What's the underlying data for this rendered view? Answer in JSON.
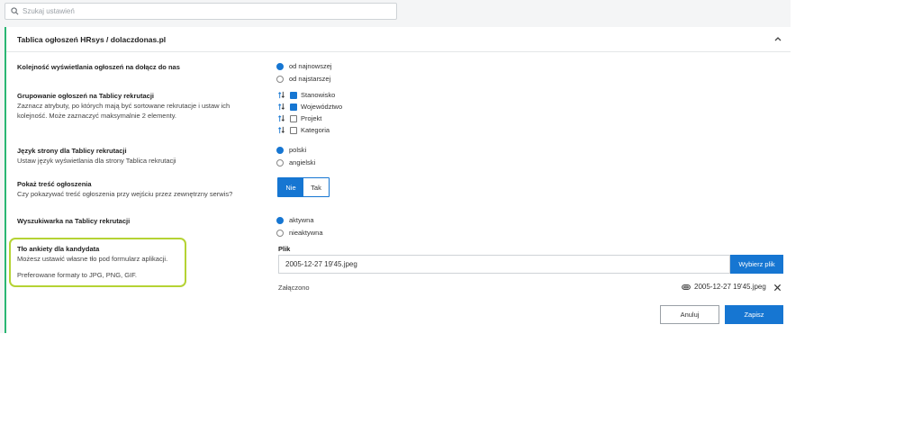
{
  "search": {
    "placeholder": "Szukaj ustawień",
    "icon": "search-icon"
  },
  "panel": {
    "title": "Tablica ogłoszeń HRsys / dolaczdonas.pl",
    "accent": "#2bb673"
  },
  "order": {
    "label": "Kolejność wyświetlania ogłoszeń na dołącz do nas",
    "options": [
      "od najnowszej",
      "od najstarszej"
    ],
    "selected": "od najnowszej"
  },
  "grouping": {
    "label": "Grupowanie ogłoszeń na Tablicy rekrutacji",
    "desc_line1": "Zaznacz atrybuty, po których mają być sortowane rekrutacje i ustaw ich",
    "desc_line2": "kolejność. Może zaznaczyć maksymalnie 2 elementy.",
    "items": [
      {
        "label": "Stanowisko",
        "checked": true
      },
      {
        "label": "Województwo",
        "checked": true
      },
      {
        "label": "Projekt",
        "checked": false
      },
      {
        "label": "Kategoria",
        "checked": false
      }
    ]
  },
  "language": {
    "label": "Język strony dla Tablicy rekrutacji",
    "desc": "Ustaw język wyświetlania dla strony Tablica rekrutacji",
    "options": [
      "polski",
      "angielski"
    ],
    "selected": "polski"
  },
  "show_content": {
    "label": "Pokaż treść ogłoszenia",
    "desc": "Czy pokazywać treść ogłoszenia przy wejściu przez zewnętrzny serwis?",
    "options": [
      "Nie",
      "Tak"
    ],
    "selected": "Nie"
  },
  "search_engine": {
    "label": "Wyszukiwarka na Tablicy rekrutacji",
    "options": [
      "aktywna",
      "nieaktywna"
    ],
    "selected": "aktywna"
  },
  "background": {
    "label": "Tło ankiety dla kandydata",
    "desc": "Możesz ustawić własne tło pod formularz aplikacji.",
    "formats": "Preferowane formaty to JPG, PNG, GIF.",
    "file_label": "Plik",
    "file_value": "2005-12-27 19'45.jpeg",
    "choose_button": "Wybierz plik",
    "attached_label": "Załączono",
    "attached_file": "2005-12-27 19'45.jpeg",
    "highlight_color": "#b5d334"
  },
  "actions": {
    "cancel": "Anuluj",
    "save": "Zapisz"
  },
  "colors": {
    "primary": "#1676d2"
  }
}
